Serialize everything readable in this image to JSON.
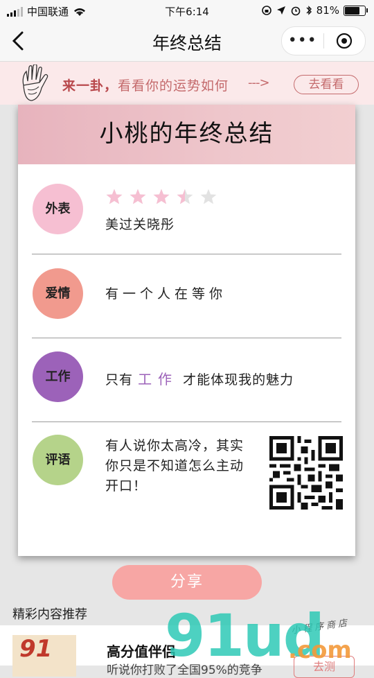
{
  "status_bar": {
    "carrier": "中国联通",
    "time": "下午6:14",
    "battery_percent": "81%",
    "battery_level": 0.81
  },
  "nav": {
    "title": "年终总结",
    "more_label": "•••"
  },
  "banner": {
    "lead": "来一卦，",
    "text": "看看你的运势如何",
    "arrow": "--->",
    "button": "去看看"
  },
  "card": {
    "title": "小桃的年终总结",
    "rows": [
      {
        "badge": "外表",
        "color": "#f6bfd2",
        "stars": 3.5,
        "stars_max": 5,
        "text": "美过关晓彤"
      },
      {
        "badge": "爱情",
        "color": "#f19a8e",
        "text": "有一个人在等你"
      },
      {
        "badge": "工作",
        "color": "#9c62b9",
        "text_before": "只有",
        "accent": "工作",
        "text_after": "才能体现我的魅力"
      },
      {
        "badge": "评语",
        "color": "#b5d38a",
        "text_line1": "有人说你太高冷，其实",
        "text_line2": "你只是不知道怎么主动",
        "text_line3": "开口！"
      }
    ]
  },
  "share": {
    "label": "分享"
  },
  "recommend": {
    "title": "精彩内容推荐",
    "item": {
      "thumb_text": "91",
      "name": "高分值伴侣",
      "subtitle": "听说你打败了全国95%的竞争",
      "button": "去测"
    }
  },
  "watermark": {
    "big": "91ud",
    "dot": ".com",
    "small": "小程序商店"
  }
}
